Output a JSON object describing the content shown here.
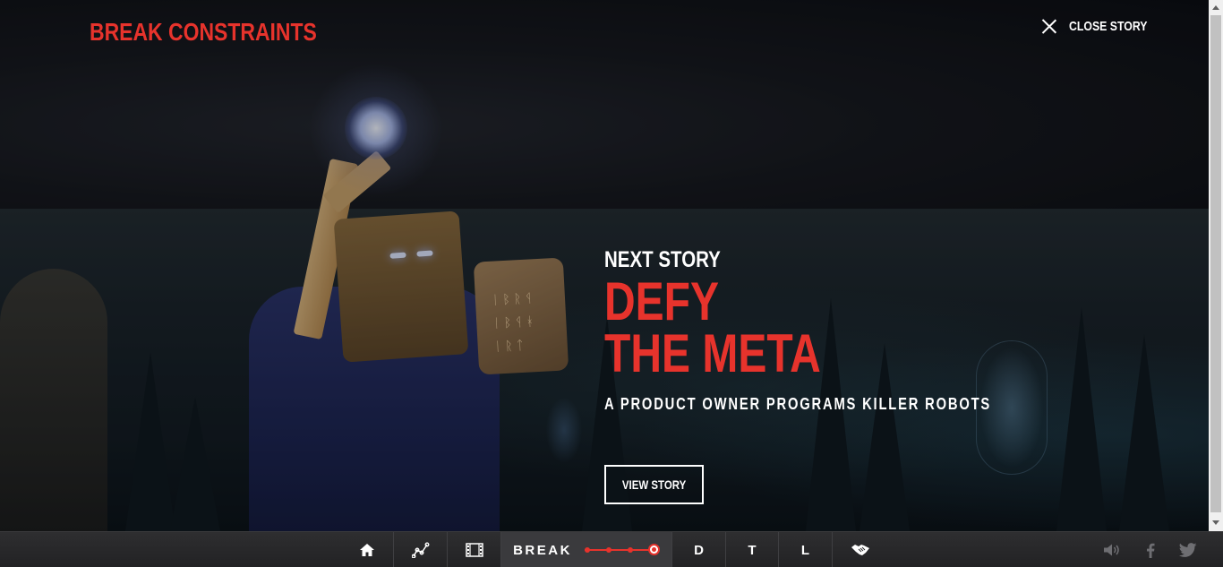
{
  "header": {
    "brand": "BREAK CONSTRAINTS",
    "close_label": "CLOSE STORY"
  },
  "next_story": {
    "eyebrow": "NEXT STORY",
    "title_line1": "DEFY",
    "title_line2": "THE META",
    "subtitle": "A PRODUCT OWNER PROGRAMS KILLER ROBOTS",
    "cta_label": "VIEW STORY"
  },
  "bottom_nav": {
    "items": [
      {
        "icon": "home-icon"
      },
      {
        "icon": "chart-line-icon"
      },
      {
        "icon": "film-icon"
      },
      {
        "label": "BREAK",
        "active": true,
        "progress_steps": 4,
        "current_step": 4
      },
      {
        "label": "D"
      },
      {
        "label": "T"
      },
      {
        "label": "L"
      },
      {
        "icon": "handshake-icon"
      }
    ],
    "social": [
      {
        "icon": "volume-icon"
      },
      {
        "icon": "facebook-icon"
      },
      {
        "icon": "twitter-icon"
      }
    ]
  },
  "colors": {
    "accent": "#e7332c",
    "nav_bg": "#2a2a2c",
    "text": "#ffffff"
  }
}
